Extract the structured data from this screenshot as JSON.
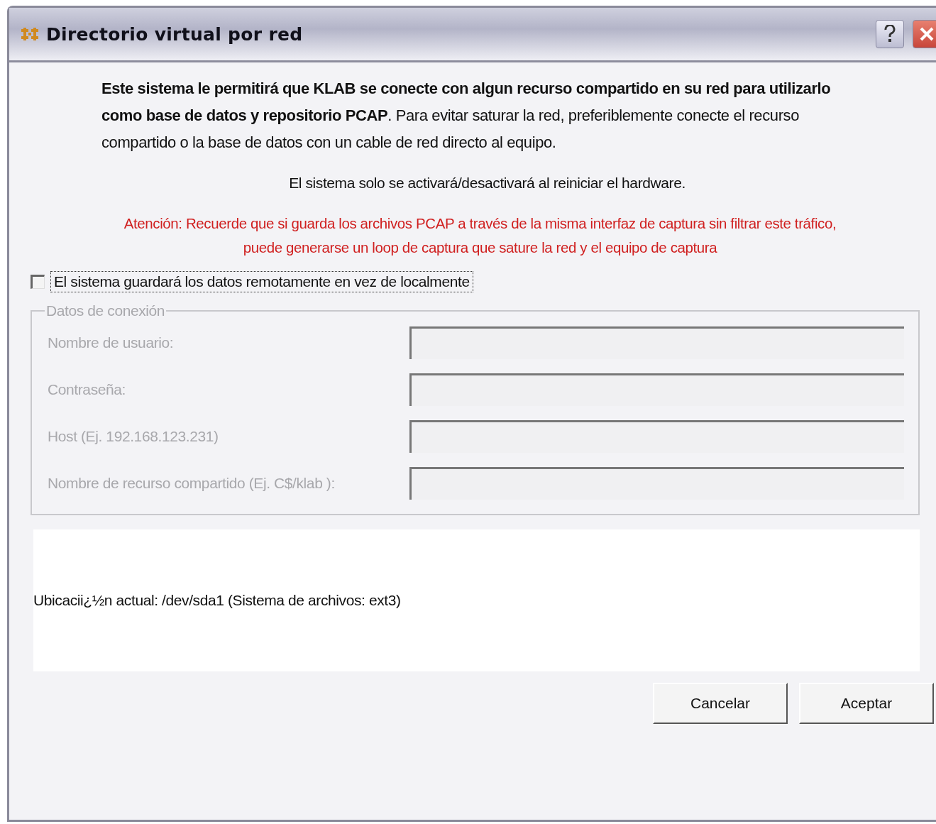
{
  "window": {
    "title": "Directorio virtual por red"
  },
  "intro": "**Este sistema le permitirá que KLAB se conecte con algun recurso compartido en su red para utilizarlo como base de datos y repositorio PCAP**. Para evitar saturar la red, preferiblemente conecte el recurso compartido o la base de datos con un cable de red directo al equipo.",
  "notice": "El sistema solo se activará/desactivará al reiniciar el hardware.",
  "warning": [
    "Atención: Recuerde que si guarda los archivos PCAP a través de la misma interfaz de captura sin filtrar este tráfico,",
    "puede generarse un loop de captura que sature la red y el equipo de captura"
  ],
  "remote_checkbox": {
    "label": "El sistema guardará los datos remotamente en vez de localmente",
    "checked": false
  },
  "connection": {
    "legend": "Datos de conexión",
    "disabled": true,
    "fields": [
      {
        "label": "Nombre de usuario:"
      },
      {
        "label": "Contraseña:"
      },
      {
        "label": "Host (Ej. 192.168.123.231)"
      },
      {
        "label": "Nombre de recurso compartido (Ej. C$/klab ):"
      }
    ]
  },
  "location": "Ubicacii¿½n actual: /dev/sda1 (Sistema de archivos: ext3)",
  "buttons": [
    {
      "label": "Cancelar"
    },
    {
      "label": "Aceptar"
    }
  ]
}
